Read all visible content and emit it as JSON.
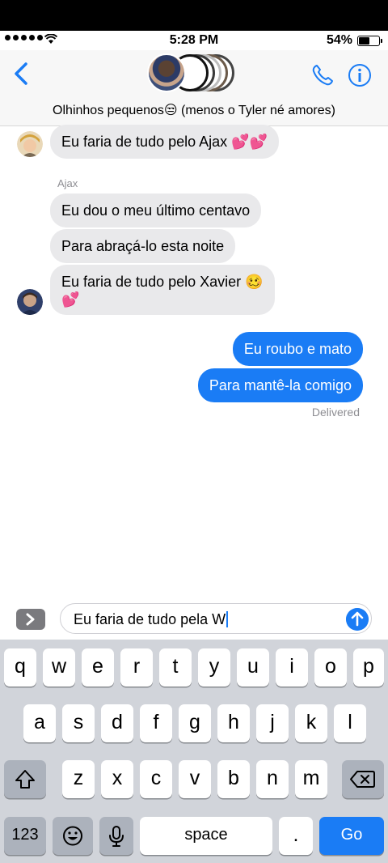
{
  "status_bar": {
    "time": "5:28 PM",
    "battery": "54%",
    "battery_level": 0.54
  },
  "header": {
    "group_name": "Olhinhos pequenos😒 (menos o Tyler né amores)"
  },
  "messages": [
    {
      "text": "Eu faria de tudo pelo Ajax 💕💕"
    },
    {
      "sender": "Ajax",
      "text": "Eu dou o meu último centavo"
    },
    {
      "text": "Para abraçá-lo esta noite"
    },
    {
      "text": "Eu faria de tudo pelo Xavier 🥴",
      "text2": "💕"
    },
    {
      "text": "Eu roubo e mato"
    },
    {
      "text": "Para mantê-la comigo"
    }
  ],
  "delivered_label": "Delivered",
  "composer": {
    "value": "Eu faria de tudo pela W"
  },
  "keyboard": {
    "row1": [
      "q",
      "w",
      "e",
      "r",
      "t",
      "y",
      "u",
      "i",
      "o",
      "p"
    ],
    "row2": [
      "a",
      "s",
      "d",
      "f",
      "g",
      "h",
      "j",
      "k",
      "l"
    ],
    "row3": [
      "z",
      "x",
      "c",
      "v",
      "b",
      "n",
      "m"
    ],
    "k123": "123",
    "space": "space",
    "period": ".",
    "go": "Go"
  },
  "colors": {
    "accent": "#1a7cf5",
    "incoming": "#e9e9eb",
    "keyboard_bg": "#d1d4da"
  }
}
